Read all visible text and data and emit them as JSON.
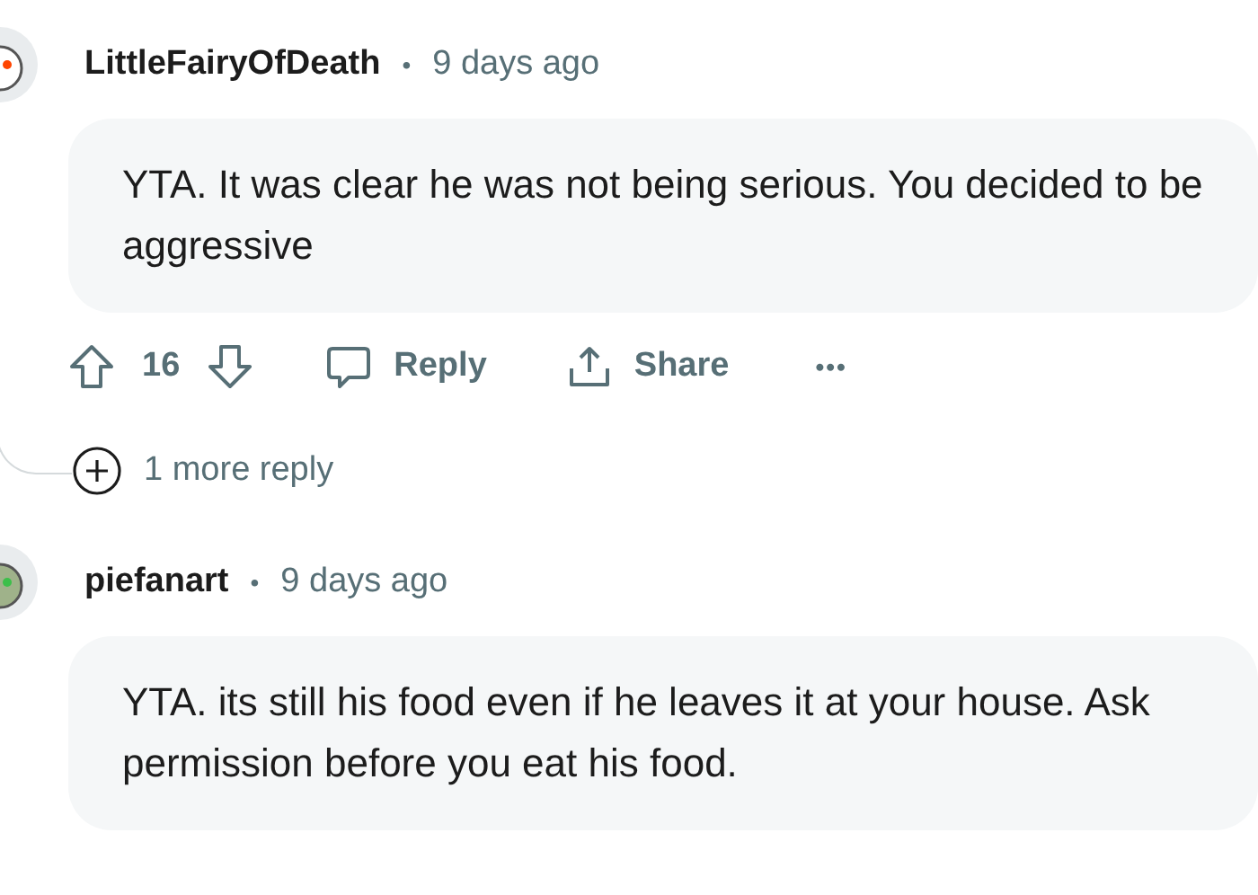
{
  "comments": [
    {
      "author": "LittleFairyOfDeath",
      "separator": "•",
      "time": "9 days ago",
      "body": "YTA. It was clear he was not being serious. You decided to be aggressive",
      "actions": {
        "votes": "16",
        "reply": "Reply",
        "share": "Share",
        "more": "•••"
      },
      "more_replies": "1 more reply"
    },
    {
      "author": "piefanart",
      "separator": "•",
      "time": "9 days ago",
      "body": "YTA. its still his food even if he leaves it at your house. Ask permission before you eat his food."
    }
  ]
}
